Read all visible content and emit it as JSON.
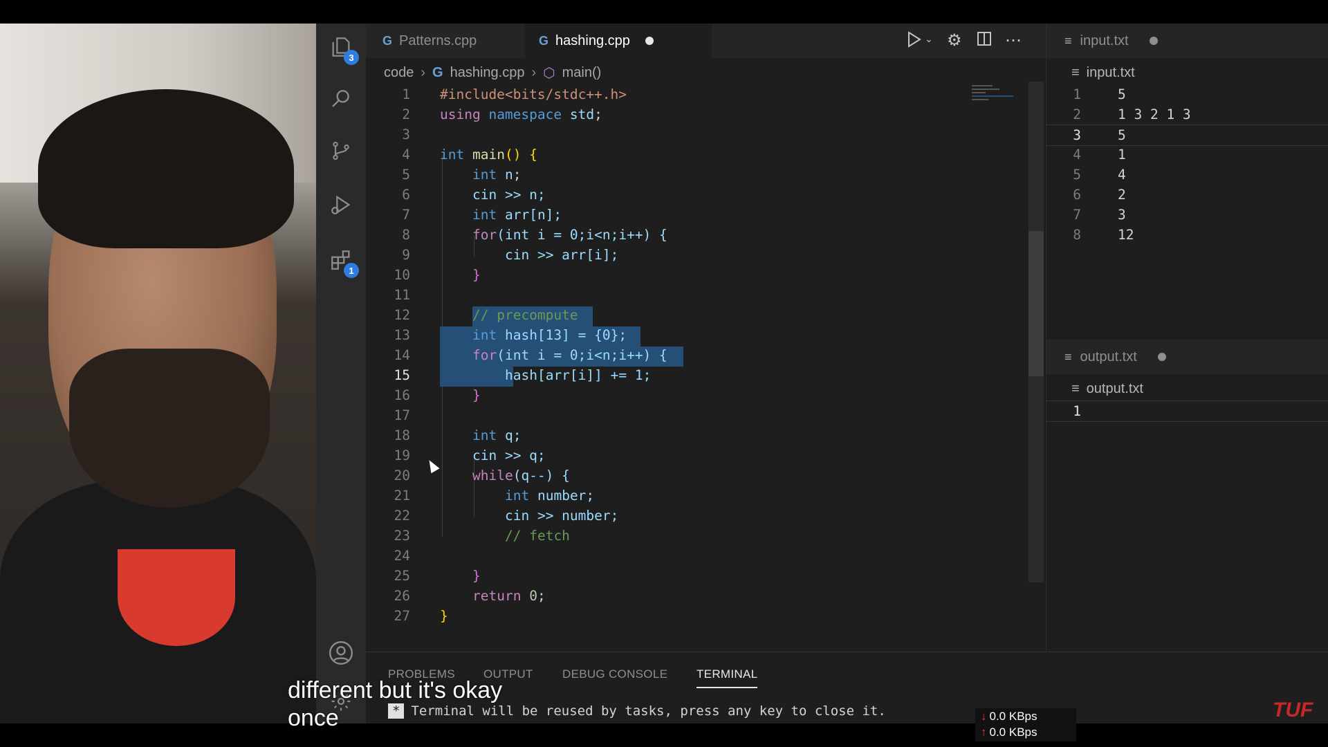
{
  "tabs": [
    {
      "label": "Patterns.cpp",
      "icon": "c-plus-plus-icon"
    },
    {
      "label": "hashing.cpp",
      "icon": "c-plus-plus-icon",
      "modified": true
    }
  ],
  "breadcrumb": {
    "folder": "code",
    "file": "hashing.cpp",
    "symbol": "main()"
  },
  "activity_badges": {
    "explorer": "3",
    "extensions": "1"
  },
  "editor": {
    "current_line": 15,
    "lines": [
      {
        "n": "1"
      },
      {
        "n": "2"
      },
      {
        "n": "3"
      },
      {
        "n": "4"
      },
      {
        "n": "5"
      },
      {
        "n": "6"
      },
      {
        "n": "7"
      },
      {
        "n": "8"
      },
      {
        "n": "9"
      },
      {
        "n": "10"
      },
      {
        "n": "11"
      },
      {
        "n": "12"
      },
      {
        "n": "13"
      },
      {
        "n": "14"
      },
      {
        "n": "15"
      },
      {
        "n": "16"
      },
      {
        "n": "17"
      },
      {
        "n": "18"
      },
      {
        "n": "19"
      },
      {
        "n": "20"
      },
      {
        "n": "21"
      },
      {
        "n": "22"
      },
      {
        "n": "23"
      },
      {
        "n": "24"
      },
      {
        "n": "25"
      },
      {
        "n": "26"
      },
      {
        "n": "27"
      }
    ]
  },
  "code": {
    "l1": "#include<bits/stdc++.h>",
    "l2_kw": "using",
    "l2_ns": "namespace",
    "l2_std": "std",
    "l4_int": "int",
    "l4_main": "main",
    "l5_int": "int",
    "l5_var": "n",
    "l6": "cin >> n;",
    "l7_int": "int",
    "l7_var": "arr[n];",
    "l8_for": "for",
    "l8_rest": "(int i = 0;i<n;i++) {",
    "l9": "cin >> arr[i];",
    "l12": "// precompute",
    "l13_int": "int",
    "l13_rest": " hash[13] = {0};",
    "l14_for": "for",
    "l14_rest": "(int i = 0;i<n;i++) {",
    "l15": "hash[arr[i]] += 1;",
    "l18_int": "int",
    "l18_var": "q;",
    "l19": "cin >> q;",
    "l20_while": "while",
    "l20_rest": "(q--) {",
    "l21_int": "int",
    "l21_var": "number;",
    "l22": "cin >> number;",
    "l23": "// fetch",
    "l26_ret": "return",
    "l26_num": "0",
    "brace_close": "}",
    "brace_open": "{"
  },
  "input_file": {
    "tab_label": "input.txt",
    "breadcrumb": "input.txt",
    "current_line": 3,
    "lines": [
      {
        "n": "1",
        "text": "5"
      },
      {
        "n": "2",
        "text": "1 3 2 1 3"
      },
      {
        "n": "3",
        "text": "5"
      },
      {
        "n": "4",
        "text": "1"
      },
      {
        "n": "5",
        "text": "4"
      },
      {
        "n": "6",
        "text": "2"
      },
      {
        "n": "7",
        "text": "3"
      },
      {
        "n": "8",
        "text": "12"
      }
    ]
  },
  "output_file": {
    "tab_label": "output.txt",
    "breadcrumb": "output.txt",
    "lines": [
      {
        "n": "1",
        "text": ""
      }
    ]
  },
  "panel": {
    "tabs": [
      "PROBLEMS",
      "OUTPUT",
      "DEBUG CONSOLE",
      "TERMINAL"
    ],
    "active_tab": "TERMINAL",
    "terminal_star": "*",
    "terminal_text": "Terminal will be reused by tasks, press any key to close it."
  },
  "caption": {
    "line1": "different but it's okay",
    "line2": "once"
  },
  "network": {
    "down": "0.0 KBps",
    "up": "0.0 KBps"
  },
  "logo": "TUF",
  "colors": {
    "editor_bg": "#1e1e1e",
    "selection": "#264f78",
    "keyword": "#569cd6",
    "badge": "#2f7de1",
    "logo": "#c62828"
  }
}
